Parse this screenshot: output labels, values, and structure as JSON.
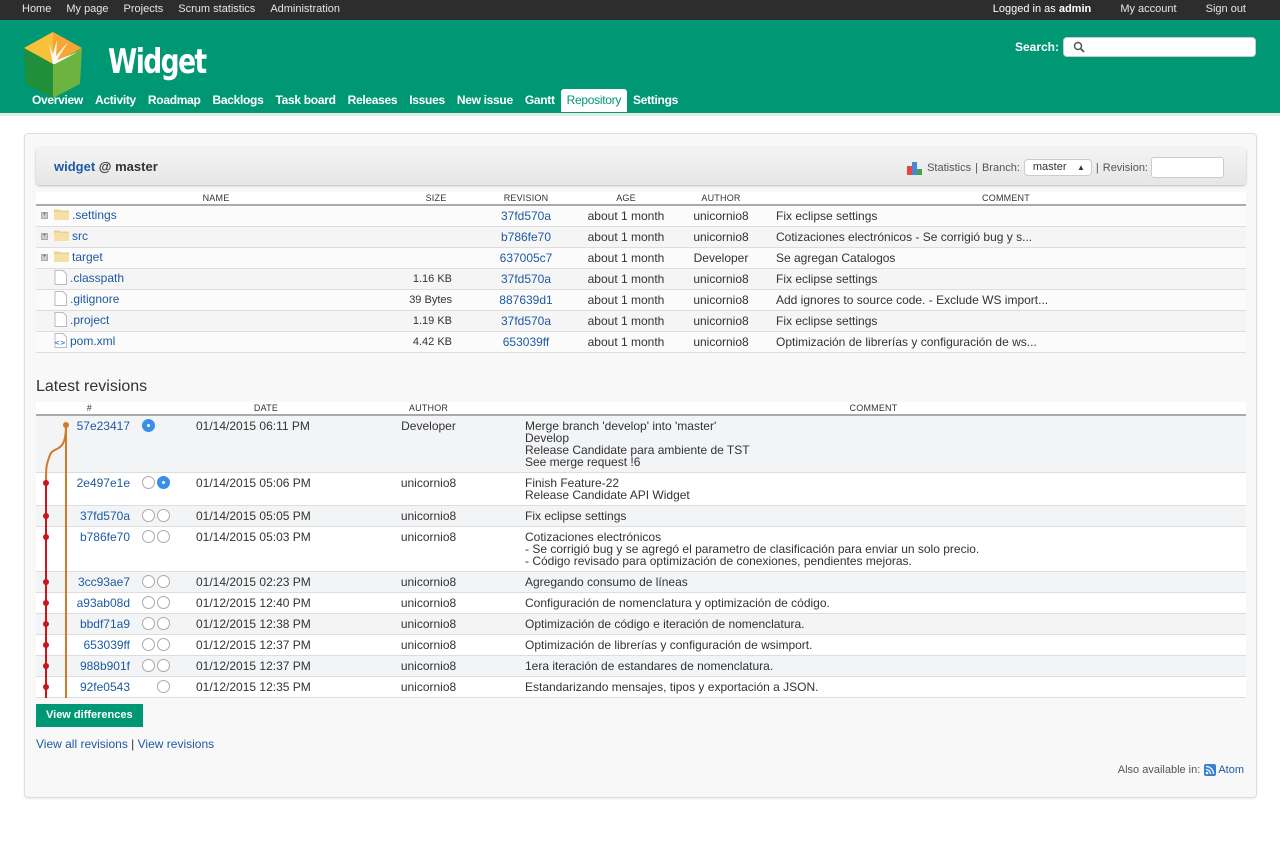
{
  "top_menu": {
    "items": [
      "Home",
      "My page",
      "Projects",
      "Scrum statistics",
      "Administration"
    ],
    "logged_in_prefix": "Logged in as",
    "user": "admin",
    "my_account": "My account",
    "sign_out": "Sign out"
  },
  "header": {
    "project_title": "Widget",
    "search_label": "Search:",
    "search_placeholder": ""
  },
  "main_menu": {
    "tabs": [
      "Overview",
      "Activity",
      "Roadmap",
      "Backlogs",
      "Task board",
      "Releases",
      "Issues",
      "New issue",
      "Gantt",
      "Repository",
      "Settings"
    ],
    "selected": "Repository"
  },
  "repo": {
    "name": "widget",
    "at": "@",
    "branch_label_short": "master",
    "statistics": "Statistics",
    "branch_label": "Branch:",
    "branch": "master",
    "revision_label": "Revision:",
    "revision_value": "",
    "sep": "|"
  },
  "files": {
    "headers": [
      "NAME",
      "SIZE",
      "REVISION",
      "AGE",
      "AUTHOR",
      "COMMENT"
    ],
    "rows": [
      {
        "type": "folder",
        "name": ".settings",
        "size": "",
        "revision": "37fd570a",
        "age": "about 1 month",
        "author": "unicornio8",
        "comment": "Fix eclipse settings"
      },
      {
        "type": "folder",
        "name": "src",
        "size": "",
        "revision": "b786fe70",
        "age": "about 1 month",
        "author": "unicornio8",
        "comment": "Cotizaciones electrónicos - Se corrigió bug y s..."
      },
      {
        "type": "folder",
        "name": "target",
        "size": "",
        "revision": "637005c7",
        "age": "about 1 month",
        "author": "Developer",
        "comment": "Se agregan Catalogos"
      },
      {
        "type": "file",
        "name": ".classpath",
        "size": "1.16 KB",
        "revision": "37fd570a",
        "age": "about 1 month",
        "author": "unicornio8",
        "comment": "Fix eclipse settings"
      },
      {
        "type": "file",
        "name": ".gitignore",
        "size": "39 Bytes",
        "revision": "887639d1",
        "age": "about 1 month",
        "author": "unicornio8",
        "comment": "Add ignores to source code. - Exclude WS import..."
      },
      {
        "type": "file",
        "name": ".project",
        "size": "1.19 KB",
        "revision": "37fd570a",
        "age": "about 1 month",
        "author": "unicornio8",
        "comment": "Fix eclipse settings"
      },
      {
        "type": "xml",
        "name": "pom.xml",
        "size": "4.42 KB",
        "revision": "653039ff",
        "age": "about 1 month",
        "author": "unicornio8",
        "comment": "Optimización de librerías y configuración de ws..."
      }
    ]
  },
  "latest": {
    "title": "Latest revisions",
    "headers": [
      "#",
      "DATE",
      "AUTHOR",
      "COMMENT"
    ],
    "rows": [
      {
        "rev": "57e23417",
        "radio1": "checked",
        "radio2": "none",
        "date": "01/14/2015 06:11 PM",
        "author": "Developer",
        "comment": [
          "Merge branch 'develop' into 'master'",
          "Develop",
          "Release Candidate para ambiente de TST",
          "See merge request !6"
        ]
      },
      {
        "rev": "2e497e1e",
        "radio1": "unchecked",
        "radio2": "checked",
        "date": "01/14/2015 05:06 PM",
        "author": "unicornio8",
        "comment": [
          "Finish Feature-22",
          "Release Candidate API Widget"
        ]
      },
      {
        "rev": "37fd570a",
        "radio1": "unchecked",
        "radio2": "unchecked",
        "date": "01/14/2015 05:05 PM",
        "author": "unicornio8",
        "comment": [
          "Fix eclipse settings"
        ]
      },
      {
        "rev": "b786fe70",
        "radio1": "unchecked",
        "radio2": "unchecked",
        "date": "01/14/2015 05:03 PM",
        "author": "unicornio8",
        "comment": [
          "Cotizaciones electrónicos",
          "- Se corrigió bug y se agregó el parametro de clasificación para enviar un solo precio.",
          "- Código revisado para optimización de conexiones, pendientes mejoras."
        ]
      },
      {
        "rev": "3cc93ae7",
        "radio1": "unchecked",
        "radio2": "unchecked",
        "date": "01/14/2015 02:23 PM",
        "author": "unicornio8",
        "comment": [
          "Agregando consumo de líneas"
        ]
      },
      {
        "rev": "a93ab08d",
        "radio1": "unchecked",
        "radio2": "unchecked",
        "date": "01/12/2015 12:40 PM",
        "author": "unicornio8",
        "comment": [
          "Configuración de nomenclatura y optimización de código."
        ]
      },
      {
        "rev": "bbdf71a9",
        "radio1": "unchecked",
        "radio2": "unchecked",
        "date": "01/12/2015 12:38 PM",
        "author": "unicornio8",
        "comment": [
          "Optimización de código e iteración de nomenclatura."
        ]
      },
      {
        "rev": "653039ff",
        "radio1": "unchecked",
        "radio2": "unchecked",
        "date": "01/12/2015 12:37 PM",
        "author": "unicornio8",
        "comment": [
          "Optimización de librerías y configuración de wsimport."
        ]
      },
      {
        "rev": "988b901f",
        "radio1": "unchecked",
        "radio2": "unchecked",
        "date": "01/12/2015 12:37 PM",
        "author": "unicornio8",
        "comment": [
          "1era iteración de estandares de nomenclatura."
        ]
      },
      {
        "rev": "92fe0543",
        "radio1": "none",
        "radio2": "unchecked",
        "date": "01/12/2015 12:35 PM",
        "author": "unicornio8",
        "comment": [
          "Estandarizando mensajes, tipos y exportación a JSON."
        ]
      }
    ],
    "view_differences": "View differences",
    "view_all": "View all revisions",
    "sep": "|",
    "view_revisions": "View revisions"
  },
  "footer": {
    "also_available": "Also available in:",
    "atom": "Atom"
  },
  "colors": {
    "brand": "#009775",
    "link": "#1d5aa3",
    "graph_main": "#c8161d",
    "graph_branch": "#d07a2a",
    "radio_checked": "#3b8fe8"
  }
}
